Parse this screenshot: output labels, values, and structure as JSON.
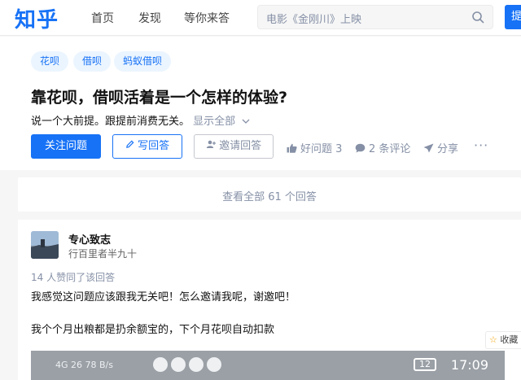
{
  "header": {
    "logo": "知乎",
    "nav": [
      "首页",
      "发现",
      "等你来答"
    ],
    "search_placeholder": "电影《金刚川》上映",
    "ask_label": "提"
  },
  "question": {
    "tags": [
      "花呗",
      "借呗",
      "蚂蚁借呗"
    ],
    "title": "靠花呗，借呗活着是一个怎样的体验?",
    "description": "说一个大前提。跟提前消费无关。",
    "show_all": "显示全部",
    "follow_label": "关注问题",
    "write_label": "写回答",
    "invite_label": "邀请回答",
    "good_question": "好问题 3",
    "comments": "2 条评论",
    "share": "分享",
    "more": "···"
  },
  "view_all": "查看全部 61 个回答",
  "answer": {
    "author": "专心致志",
    "headline": "行百里者半九十",
    "votes": "14 人赞同了该回答",
    "paragraphs": [
      "我感觉这问题应该跟我无关吧！怎么邀请我呢，谢邀吧！",
      "我个个月出粮都是扔余额宝的，下个月花呗自动扣款"
    ],
    "collect_label": "收藏"
  },
  "statusbar": {
    "left": "4G  26  78 B/s",
    "battery": "12",
    "time": "17:09"
  },
  "colors": {
    "brand": "#1772f6",
    "muted": "#8590a6"
  }
}
